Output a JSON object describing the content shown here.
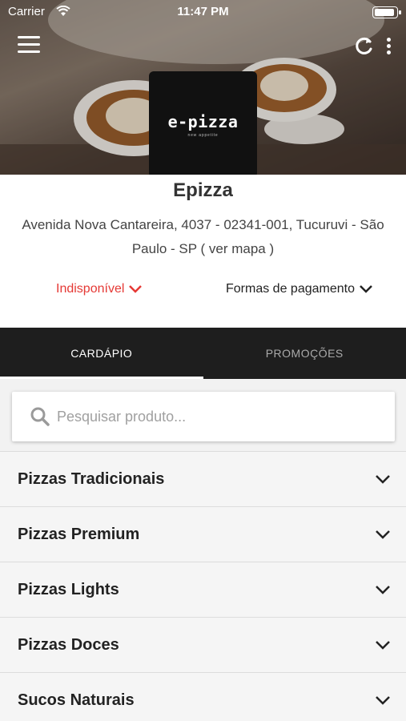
{
  "status_bar": {
    "carrier": "Carrier",
    "time": "11:47 PM",
    "battery_level": 0.95
  },
  "icons": {
    "menu": "hamburger-icon",
    "refresh": "refresh-icon",
    "more": "more-vertical-icon",
    "wifi": "wifi-icon",
    "battery": "battery-icon",
    "search": "search-icon",
    "chevron": "chevron-down-icon"
  },
  "restaurant": {
    "logo_text": "e-pizza",
    "logo_tagline": "new appetite",
    "name": "Epizza",
    "address": "Avenida Nova Cantareira, 4037 - 02341-001, Tucuruvi - São Paulo - SP ( ver mapa )",
    "status": "Indisponível",
    "payment_label": "Formas de pagamento"
  },
  "colors": {
    "status_unavailable": "#e53935",
    "tab_bar": "#1e1e1e"
  },
  "tabs": [
    {
      "label": "CARDÁPIO",
      "active": true
    },
    {
      "label": "PROMOÇÕES",
      "active": false
    }
  ],
  "search": {
    "placeholder": "Pesquisar produto...",
    "value": ""
  },
  "categories": [
    {
      "label": "Pizzas Tradicionais"
    },
    {
      "label": "Pizzas Premium"
    },
    {
      "label": "Pizzas Lights"
    },
    {
      "label": "Pizzas Doces"
    },
    {
      "label": "Sucos Naturais"
    }
  ]
}
